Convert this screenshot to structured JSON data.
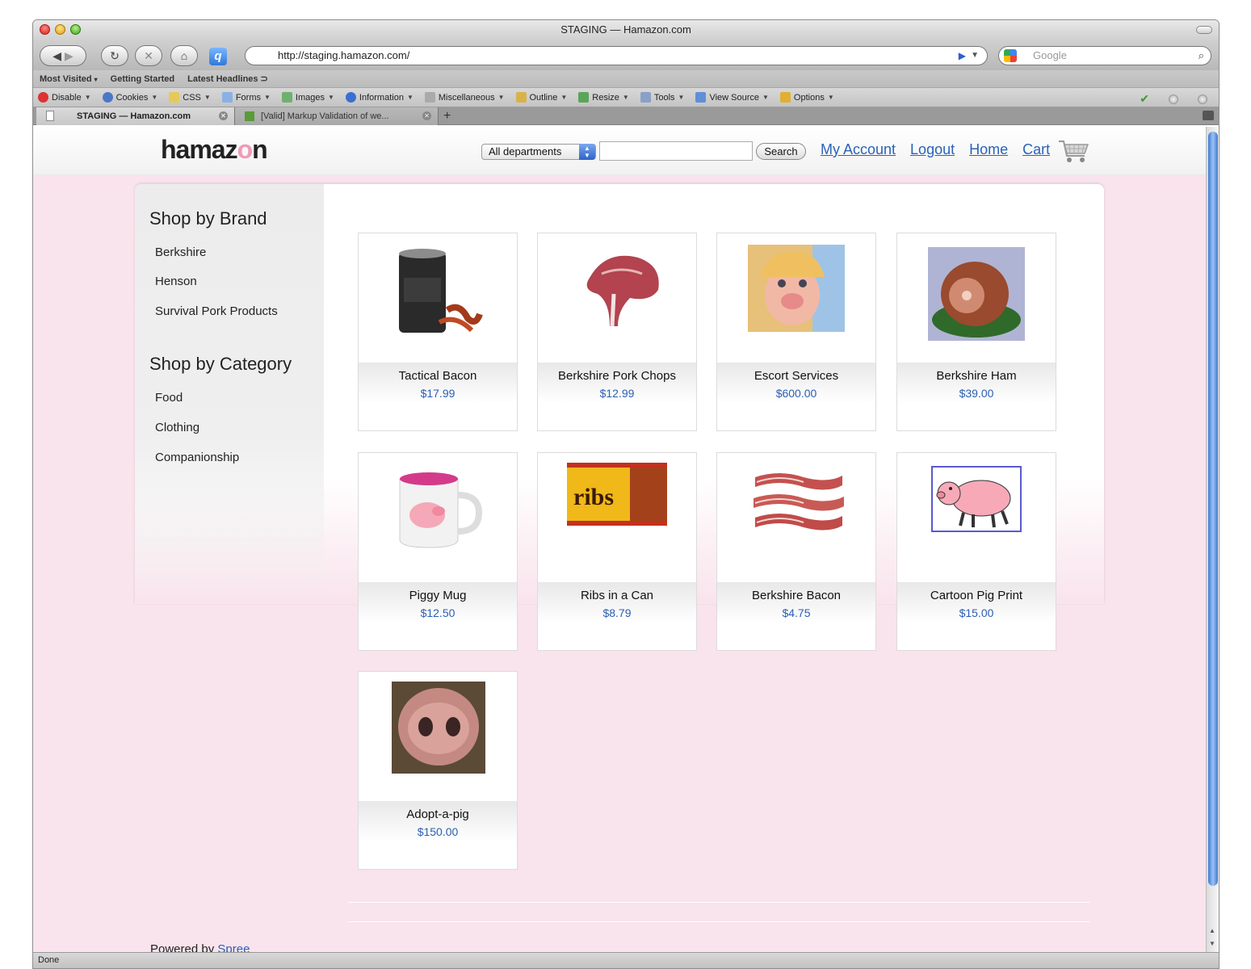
{
  "window": {
    "title": "STAGING — Hamazon.com"
  },
  "browser": {
    "url": "http://staging.hamazon.com/",
    "search_placeholder": "Google",
    "bookmarks": [
      "Most Visited",
      "Getting Started",
      "Latest Headlines"
    ],
    "webdev_menu": [
      "Disable",
      "Cookies",
      "CSS",
      "Forms",
      "Images",
      "Information",
      "Miscellaneous",
      "Outline",
      "Resize",
      "Tools",
      "View Source",
      "Options"
    ],
    "tabs": [
      "STAGING — Hamazon.com",
      "[Valid] Markup Validation of we..."
    ],
    "status": "Done"
  },
  "site": {
    "logo_prefix": "hamaz",
    "logo_o": "o",
    "logo_suffix": "n",
    "department_select": "All departments",
    "search_button": "Search",
    "nav": [
      "My Account",
      "Logout",
      "Home",
      "Cart"
    ],
    "brand_heading": "Shop by Brand",
    "brands": [
      "Berkshire",
      "Henson",
      "Survival Pork Products"
    ],
    "category_heading": "Shop by Category",
    "categories": [
      "Food",
      "Clothing",
      "Companionship"
    ],
    "powered_by": "Powered by",
    "powered_link": "Spree"
  },
  "products": [
    {
      "name": "Tactical Bacon",
      "price": "$17.99"
    },
    {
      "name": "Berkshire Pork Chops",
      "price": "$12.99"
    },
    {
      "name": "Escort Services",
      "price": "$600.00"
    },
    {
      "name": "Berkshire Ham",
      "price": "$39.00"
    },
    {
      "name": "Piggy Mug",
      "price": "$12.50"
    },
    {
      "name": "Ribs in a Can",
      "price": "$8.79"
    },
    {
      "name": "Berkshire Bacon",
      "price": "$4.75"
    },
    {
      "name": "Cartoon Pig Print",
      "price": "$15.00"
    },
    {
      "name": "Adopt-a-pig",
      "price": "$150.00"
    }
  ],
  "ribs_label": "ribs",
  "colors": {
    "page_bg": "#f9e3ec",
    "link": "#2a63b8",
    "price": "#2b5fb3"
  }
}
